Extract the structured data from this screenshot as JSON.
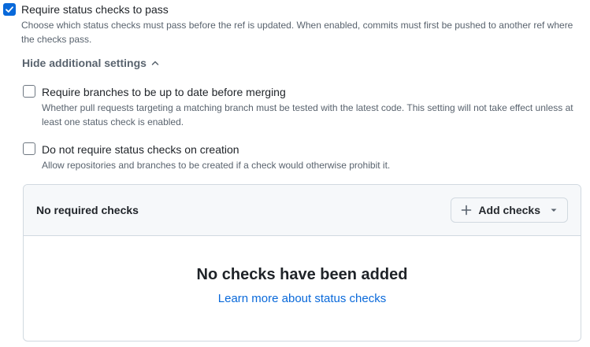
{
  "status_checks": {
    "checked": true,
    "label": "Require status checks to pass",
    "description": "Choose which status checks must pass before the ref is updated. When enabled, commits must first be pushed to another ref where the checks pass."
  },
  "additional_settings_toggle": {
    "label": "Hide additional settings",
    "icon": "chevron-up-icon"
  },
  "up_to_date": {
    "checked": false,
    "label": "Require branches to be up to date before merging",
    "description": "Whether pull requests targeting a matching branch must be tested with the latest code. This setting will not take effect unless at least one status check is enabled."
  },
  "on_creation": {
    "checked": false,
    "label": "Do not require status checks on creation",
    "description": "Allow repositories and branches to be created if a check would otherwise prohibit it."
  },
  "checks_panel": {
    "title": "No required checks",
    "add_button": {
      "label": "Add checks",
      "icon": "plus-icon",
      "dropdown_icon": "caret-down-icon"
    },
    "empty_state": {
      "title": "No checks have been added",
      "link": "Learn more about status checks"
    }
  },
  "colors": {
    "accent": "#0969da",
    "muted_text": "#59636e",
    "border": "#d1d9e0"
  }
}
